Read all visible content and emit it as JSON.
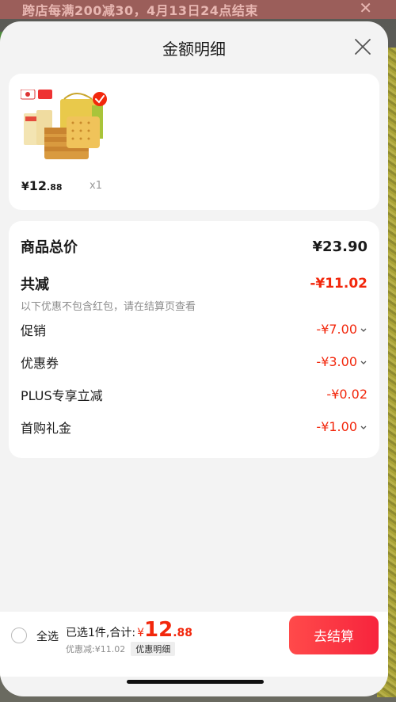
{
  "background": {
    "promo_text": "跨店每满200减30，4月13日24点结束",
    "promo_close": "✕"
  },
  "sheet": {
    "title": "金额明细",
    "close_icon": "close-icon"
  },
  "product": {
    "currency": "¥",
    "price_int": "12",
    "price_dec": ".88",
    "quantity": "x1",
    "thumbnail": "biscuit-product-image"
  },
  "details": {
    "total_label": "商品总价",
    "total_value": "¥23.90",
    "reduce_label": "共减",
    "reduce_value": "-¥11.02",
    "reduce_note": "以下优惠不包含红包，请在结算页查看",
    "items": [
      {
        "label": "促销",
        "value": "-¥7.00",
        "expandable": true
      },
      {
        "label": "优惠券",
        "value": "-¥3.00",
        "expandable": true
      },
      {
        "label": "PLUS专享立减",
        "value": "-¥0.02",
        "expandable": false
      },
      {
        "label": "首购礼金",
        "value": "-¥1.00",
        "expandable": true
      }
    ]
  },
  "bottom_bar": {
    "select_all": "全选",
    "selected_text": "已选1件,合计:",
    "currency": "¥",
    "amount_int": "12",
    "amount_dec": ".88",
    "discount_text": "优惠减:¥11.02",
    "detail_link": "优惠明细",
    "checkout": "去结算"
  },
  "colors": {
    "accent": "#f2270c",
    "sheet_bg": "#f3f3f3"
  }
}
